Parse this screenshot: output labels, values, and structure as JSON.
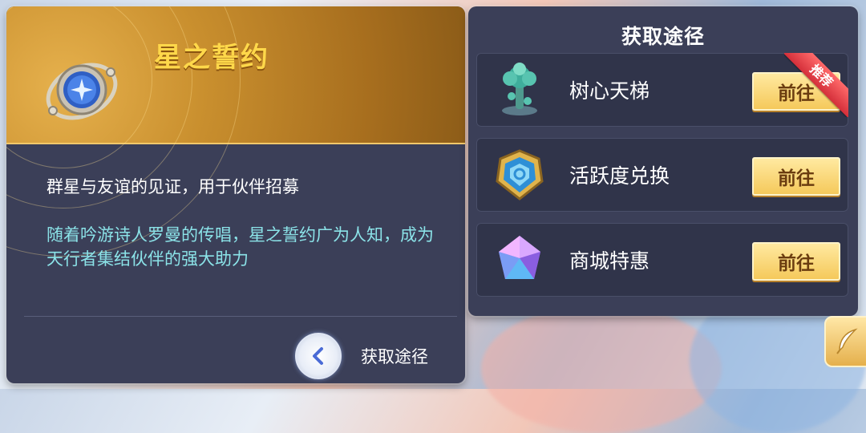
{
  "item": {
    "name": "星之誓约",
    "description": "群星与友谊的见证，用于伙伴招募",
    "lore": "随着吟游诗人罗曼的传唱，星之誓约广为人知，成为天行者集结伙伴的强大助力",
    "acquire_label": "获取途径",
    "icon": "star-orb-icon"
  },
  "sources": {
    "title": "获取途径",
    "items": [
      {
        "name": "树心天梯",
        "button": "前往",
        "icon": "tree-icon",
        "tag": "推荐"
      },
      {
        "name": "活跃度兑换",
        "button": "前往",
        "icon": "crest-icon",
        "tag": ""
      },
      {
        "name": "商城特惠",
        "button": "前往",
        "icon": "crystal-icon",
        "tag": ""
      }
    ]
  },
  "colors": {
    "panel": "#3b3f58",
    "title_gold": "#ffd84a",
    "lore_cyan": "#8be3e8",
    "button_gold": "#f5c95b",
    "ribbon_red": "#d42f3a"
  }
}
